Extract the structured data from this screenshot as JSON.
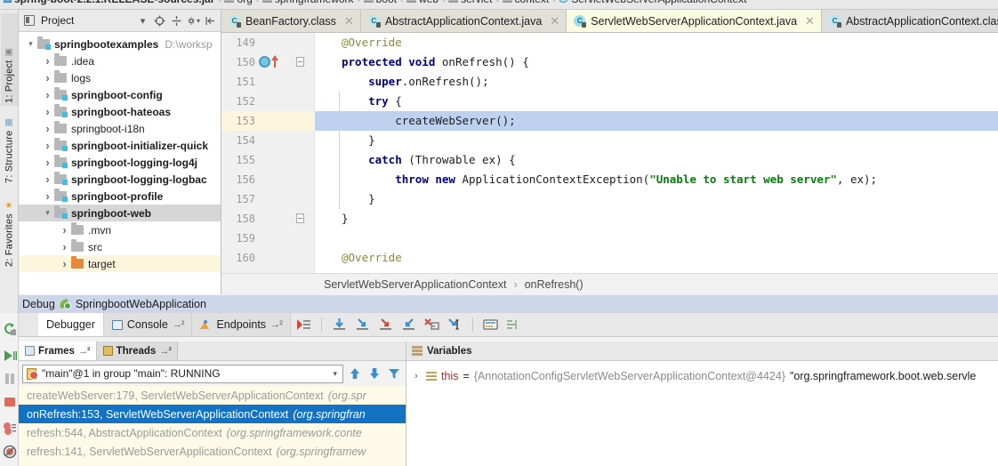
{
  "top_breadcrumb": {
    "items": [
      {
        "label": "spring-boot-2.2.1.RELEASE-sources.jar",
        "icon": "jar-icon",
        "bold": true
      },
      {
        "label": "org",
        "icon": "package-icon"
      },
      {
        "label": "springframework",
        "icon": "package-icon"
      },
      {
        "label": "boot",
        "icon": "package-icon"
      },
      {
        "label": "web",
        "icon": "package-icon"
      },
      {
        "label": "servlet",
        "icon": "package-icon"
      },
      {
        "label": "context",
        "icon": "package-icon"
      },
      {
        "label": "ServletWebServerApplicationContext",
        "icon": "class-icon"
      }
    ]
  },
  "left_strip": {
    "tabs": [
      {
        "label": "1: Project",
        "icon": "project-icon",
        "selected": true
      },
      {
        "label": "7: Structure",
        "icon": "structure-icon",
        "selected": false
      },
      {
        "label": "2: Favorites",
        "icon": "star-icon",
        "selected": false
      }
    ]
  },
  "project_panel": {
    "title": "Project",
    "toolbar": [
      "chevron-down-icon",
      "locate-icon",
      "collapse-all-icon",
      "gear-icon",
      "hide-icon"
    ],
    "tree": [
      {
        "label": "springbootexamples",
        "path": "D:\\worksp",
        "depth": 0,
        "state": "open",
        "folder": "module",
        "bold": true
      },
      {
        "label": ".idea",
        "depth": 1,
        "state": "closed",
        "folder": "plain",
        "bold": false
      },
      {
        "label": "logs",
        "depth": 1,
        "state": "closed",
        "folder": "plain",
        "bold": false
      },
      {
        "label": "springboot-config",
        "depth": 1,
        "state": "closed",
        "folder": "module",
        "bold": true
      },
      {
        "label": "springboot-hateoas",
        "depth": 1,
        "state": "closed",
        "folder": "module",
        "bold": true
      },
      {
        "label": "springboot-i18n",
        "depth": 1,
        "state": "closed",
        "folder": "plain",
        "bold": false
      },
      {
        "label": "springboot-initializer-quick",
        "depth": 1,
        "state": "closed",
        "folder": "module",
        "bold": true
      },
      {
        "label": "springboot-logging-log4j",
        "depth": 1,
        "state": "closed",
        "folder": "module",
        "bold": true
      },
      {
        "label": "springboot-logging-logbac",
        "depth": 1,
        "state": "closed",
        "folder": "module",
        "bold": true
      },
      {
        "label": "springboot-profile",
        "depth": 1,
        "state": "closed",
        "folder": "module",
        "bold": true
      },
      {
        "label": "springboot-web",
        "depth": 1,
        "state": "open",
        "folder": "module",
        "bold": true,
        "selected": true
      },
      {
        "label": ".mvn",
        "depth": 2,
        "state": "closed",
        "folder": "plain",
        "bold": false
      },
      {
        "label": "src",
        "depth": 2,
        "state": "closed",
        "folder": "plain",
        "bold": false
      },
      {
        "label": "target",
        "depth": 2,
        "state": "closed",
        "folder": "target",
        "bold": false,
        "highlighted": true
      }
    ]
  },
  "editor_tabs": [
    {
      "label": "BeanFactory.class",
      "icon": "class-file-icon",
      "active": false,
      "closable": true,
      "style": "compiled"
    },
    {
      "label": "AbstractApplicationContext.java",
      "icon": "java-class-icon",
      "active": false,
      "closable": true,
      "style": "compiled"
    },
    {
      "label": "ServletWebServerApplicationContext.java",
      "icon": "java-class-icon",
      "active": true,
      "closable": true,
      "style": "active"
    },
    {
      "label": "AbstractApplicationContext.class",
      "icon": "class-file-icon",
      "active": false,
      "closable": true,
      "style": "plain"
    }
  ],
  "editor": {
    "first_line": 149,
    "cursor_line": 153,
    "breakpoint_line": 150,
    "lines": [
      {
        "n": 149,
        "tokens": [
          {
            "t": "annotation",
            "s": "@Override"
          }
        ]
      },
      {
        "n": 150,
        "tokens": [
          {
            "t": "kw",
            "s": "protected void "
          },
          {
            "t": "plain",
            "s": "onRefresh() {"
          }
        ]
      },
      {
        "n": 151,
        "tokens": [
          {
            "t": "pad",
            "s": "    "
          },
          {
            "t": "kw",
            "s": "super"
          },
          {
            "t": "plain",
            "s": ".onRefresh();"
          }
        ]
      },
      {
        "n": 152,
        "tokens": [
          {
            "t": "pad",
            "s": "    "
          },
          {
            "t": "kw",
            "s": "try"
          },
          {
            "t": "plain",
            "s": " {"
          }
        ]
      },
      {
        "n": 153,
        "tokens": [
          {
            "t": "pad",
            "s": "        "
          },
          {
            "t": "plain",
            "s": "createWebServer();"
          }
        ]
      },
      {
        "n": 154,
        "tokens": [
          {
            "t": "pad",
            "s": "    "
          },
          {
            "t": "plain",
            "s": "}"
          }
        ]
      },
      {
        "n": 155,
        "tokens": [
          {
            "t": "pad",
            "s": "    "
          },
          {
            "t": "kw",
            "s": "catch"
          },
          {
            "t": "plain",
            "s": " (Throwable ex) {"
          }
        ]
      },
      {
        "n": 156,
        "tokens": [
          {
            "t": "pad",
            "s": "        "
          },
          {
            "t": "kw",
            "s": "throw new "
          },
          {
            "t": "plain",
            "s": "ApplicationContextException("
          },
          {
            "t": "str",
            "s": "\"Unable to start web server\""
          },
          {
            "t": "plain",
            "s": ", ex);"
          }
        ]
      },
      {
        "n": 157,
        "tokens": [
          {
            "t": "pad",
            "s": "    "
          },
          {
            "t": "plain",
            "s": "}"
          }
        ]
      },
      {
        "n": 158,
        "tokens": [
          {
            "t": "plain",
            "s": "}"
          }
        ]
      },
      {
        "n": 159,
        "tokens": []
      },
      {
        "n": 160,
        "tokens": [
          {
            "t": "annotation",
            "s": "@Override"
          }
        ]
      }
    ],
    "breadcrumb": [
      "ServletWebServerApplicationContext",
      "onRefresh()"
    ],
    "breadcrumb_sep": "›"
  },
  "debug": {
    "header_title": "Debug",
    "config_name": "SpringbootWebApplication",
    "tabs": [
      {
        "label": "Debugger",
        "active": true,
        "icon": null
      },
      {
        "label": "Console",
        "active": false,
        "icon": "console-icon",
        "pin": true
      },
      {
        "label": "Endpoints",
        "active": false,
        "icon": "endpoints-icon",
        "pin": true
      }
    ],
    "toolbar_icons": [
      "show-execution-point-icon",
      "step-over-icon",
      "step-into-icon",
      "force-step-into-icon",
      "step-out-icon",
      "drop-frame-icon",
      "run-to-cursor-icon",
      "evaluate-expression-icon",
      "trace-current-stream-icon"
    ],
    "rail_icons": [
      "rerun-icon",
      "resume-program-icon",
      "pause-program-icon",
      "stop-icon",
      "view-breakpoints-icon",
      "mute-breakpoints-icon"
    ],
    "frames": {
      "tabs": [
        {
          "label": "Frames",
          "icon": "frames-icon",
          "active": true,
          "pin": true
        },
        {
          "label": "Threads",
          "icon": "threads-icon",
          "active": false,
          "pin": true
        }
      ],
      "thread_selector": {
        "value": "\"main\"@1 in group \"main\": RUNNING",
        "icon": "thread-running-icon"
      },
      "thread_buttons": [
        "up-arrow-icon",
        "down-arrow-icon",
        "filter-icon"
      ],
      "stack": [
        {
          "method": "createWebServer:179, ServletWebServerApplicationContext",
          "pkg": "(org.spr",
          "selected": false
        },
        {
          "method": "onRefresh:153, ServletWebServerApplicationContext",
          "pkg": "(org.springfran",
          "selected": true
        },
        {
          "method": "refresh:544, AbstractApplicationContext",
          "pkg": "(org.springframework.conte",
          "selected": false
        },
        {
          "method": "refresh:141, ServletWebServerApplicationContext",
          "pkg": "(org.springframew",
          "selected": false
        }
      ]
    },
    "variables": {
      "title": "Variables",
      "rows": [
        {
          "expander": "›",
          "icon": "variable-icon",
          "name": "this",
          "eq": "=",
          "value": "{AnnotationConfigServletWebServerApplicationContext@4424}",
          "string": "\"org.springframework.boot.web.servle"
        }
      ]
    }
  },
  "colors": {
    "accent_blue": "#1372c4",
    "keyword": "#00008b",
    "string": "#048008",
    "annotation": "#8a8a3a",
    "cursor_line": "#bed2f0",
    "gutter_highlight": "#fdf6dd",
    "debug_header": "#cdd6e8"
  }
}
